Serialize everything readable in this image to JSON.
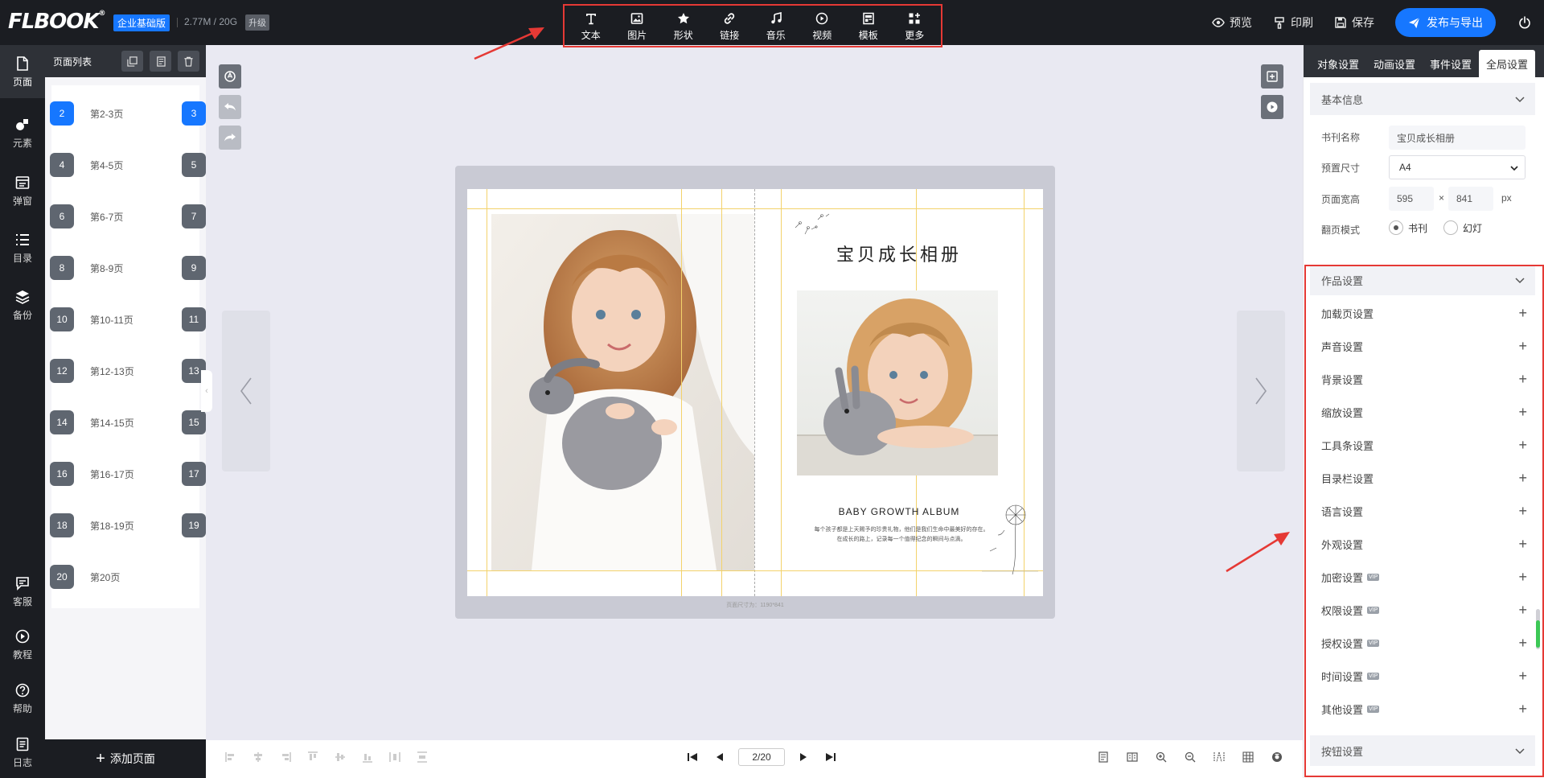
{
  "app": {
    "logo": "FLBOOK",
    "logo_reg": "®",
    "edition": "企业基础版",
    "storage": "2.77M / 20G",
    "upgrade": "升级"
  },
  "toolbar": {
    "tools": [
      {
        "label": "文本",
        "icon": "text-icon"
      },
      {
        "label": "图片",
        "icon": "image-icon"
      },
      {
        "label": "形状",
        "icon": "star-icon"
      },
      {
        "label": "链接",
        "icon": "link-icon"
      },
      {
        "label": "音乐",
        "icon": "music-icon"
      },
      {
        "label": "视频",
        "icon": "play-circle-icon"
      },
      {
        "label": "模板",
        "icon": "template-icon"
      },
      {
        "label": "更多",
        "icon": "apps-icon"
      }
    ],
    "preview": "预览",
    "print": "印刷",
    "save": "保存",
    "publish": "发布与导出"
  },
  "leftnav": {
    "items": [
      {
        "label": "页面",
        "icon": "page-icon"
      },
      {
        "label": "元素",
        "icon": "elements-icon"
      },
      {
        "label": "弹窗",
        "icon": "popup-icon"
      },
      {
        "label": "目录",
        "icon": "list-icon"
      },
      {
        "label": "备份",
        "icon": "layers-icon"
      }
    ],
    "bottom": [
      {
        "label": "客服",
        "icon": "chat-icon"
      },
      {
        "label": "教程",
        "icon": "play-icon"
      },
      {
        "label": "帮助",
        "icon": "help-icon"
      },
      {
        "label": "日志",
        "icon": "log-icon"
      }
    ]
  },
  "pagelist": {
    "title": "页面列表",
    "rows": [
      {
        "left": "2",
        "label": "第2-3页",
        "right": "3",
        "active": true
      },
      {
        "left": "4",
        "label": "第4-5页",
        "right": "5"
      },
      {
        "left": "6",
        "label": "第6-7页",
        "right": "7"
      },
      {
        "left": "8",
        "label": "第8-9页",
        "right": "9"
      },
      {
        "left": "10",
        "label": "第10-11页",
        "right": "11"
      },
      {
        "left": "12",
        "label": "第12-13页",
        "right": "13"
      },
      {
        "left": "14",
        "label": "第14-15页",
        "right": "15"
      },
      {
        "left": "16",
        "label": "第16-17页",
        "right": "17"
      },
      {
        "left": "18",
        "label": "第18-19页",
        "right": "19"
      },
      {
        "left": "20",
        "label": "第20页",
        "right": ""
      }
    ],
    "add_page": "添加页面"
  },
  "canvas": {
    "album_title": "宝贝成长相册",
    "album_en": "BABY GROWTH ALBUM",
    "album_desc_line1": "每个孩子都是上天赐予的珍贵礼物，他们是我们生命中最美好的存在。",
    "album_desc_line2": "在成长的路上，记录每一个值得纪念的瞬间与点滴。",
    "dimensions": "页面尺寸为：1190*841"
  },
  "pager": {
    "current": "2/20"
  },
  "rightpanel": {
    "tabs": [
      "对象设置",
      "动画设置",
      "事件设置",
      "全局设置"
    ],
    "basic_info": "基本信息",
    "book_name_label": "书刊名称",
    "book_name": "宝贝成长相册",
    "preset_size_label": "预置尺寸",
    "preset_size": "A4",
    "page_size_label": "页面宽高",
    "width": "595",
    "times": "×",
    "height": "841",
    "unit": "px",
    "flip_mode_label": "翻页模式",
    "flip_book": "书刊",
    "flip_slide": "幻灯",
    "work_settings": "作品设置",
    "settings": [
      {
        "label": "加载页设置",
        "vip": ""
      },
      {
        "label": "声音设置",
        "vip": ""
      },
      {
        "label": "背景设置",
        "vip": ""
      },
      {
        "label": "缩放设置",
        "vip": ""
      },
      {
        "label": "工具条设置",
        "vip": ""
      },
      {
        "label": "目录栏设置",
        "vip": ""
      },
      {
        "label": "语言设置",
        "vip": ""
      },
      {
        "label": "外观设置",
        "vip": ""
      },
      {
        "label": "加密设置",
        "vip": "VIP"
      },
      {
        "label": "权限设置",
        "vip": "VIP"
      },
      {
        "label": "授权设置",
        "vip": "VIP"
      },
      {
        "label": "时间设置",
        "vip": "VIP"
      },
      {
        "label": "其他设置",
        "vip": "VIP"
      }
    ],
    "button_settings": "按钮设置"
  }
}
